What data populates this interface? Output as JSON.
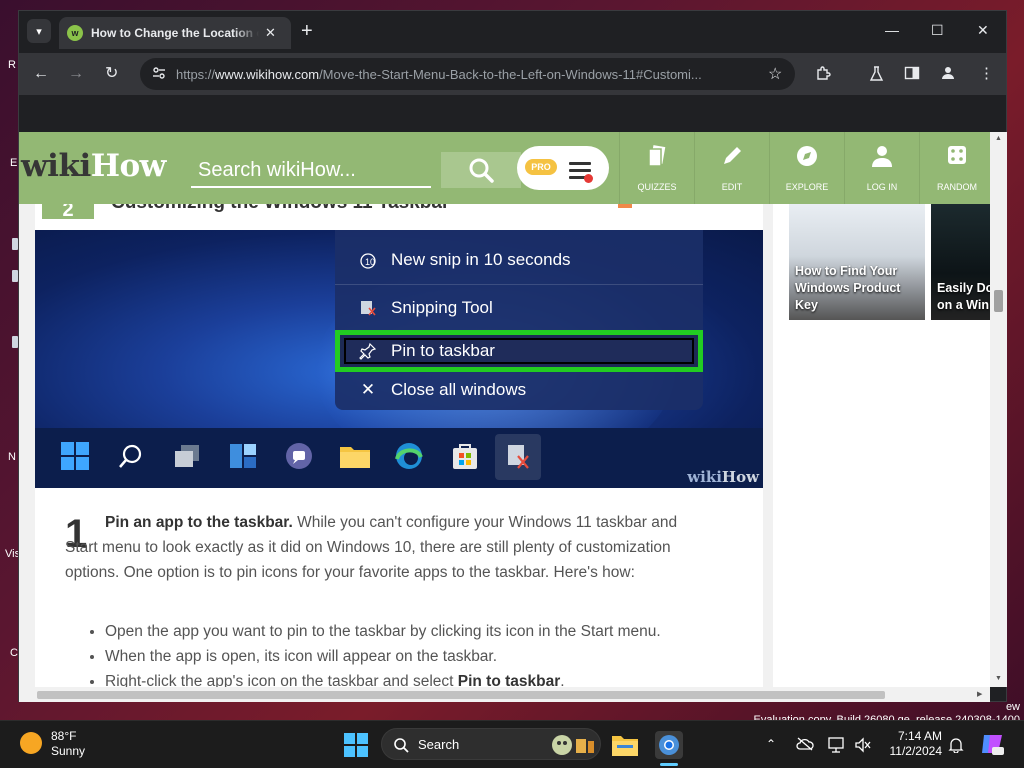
{
  "desktop": {
    "icon_label_fragments": [
      "R",
      "E",
      "N",
      "Vis",
      "C"
    ]
  },
  "browser": {
    "tab": {
      "title": "How to Change the Location o",
      "close": "✕"
    },
    "new_tab": "+",
    "window_controls": {
      "minimize": "—",
      "maximize": "☐",
      "close": "✕"
    },
    "nav": {
      "back": "←",
      "forward": "→",
      "reload": "↻"
    },
    "address": {
      "prefix": "https://",
      "host": "www.wikihow.com",
      "path": "/Move-the-Start-Menu-Back-to-the-Left-on-Windows-11#Customi..."
    },
    "bookmark_star": "☆"
  },
  "wikihow": {
    "logo_wiki": "wiki",
    "logo_how": "How",
    "search_placeholder": "Search wikiHow...",
    "pro_badge": "PRO",
    "nav": [
      {
        "icon": "quizzes-icon",
        "label": "QUIZZES"
      },
      {
        "icon": "edit-icon",
        "label": "EDIT"
      },
      {
        "icon": "explore-icon",
        "label": "EXPLORE"
      },
      {
        "icon": "login-icon",
        "label": "LOG IN"
      },
      {
        "icon": "random-icon",
        "label": "RANDOM"
      }
    ],
    "step_section_num": "2",
    "step_section_title": "Customizing the Windows 11 Taskbar",
    "screenshot": {
      "menu_items": [
        {
          "icon": "timer-icon",
          "label": "New snip in 10 seconds"
        },
        {
          "icon": "snipping-tool-icon",
          "label": "Snipping Tool"
        },
        {
          "icon": "pin-icon",
          "label": "Pin to taskbar"
        },
        {
          "icon": "close-icon",
          "label": "Close all windows"
        }
      ],
      "watermark_wiki": "wiki",
      "watermark_how": "How"
    },
    "step": {
      "number": "1",
      "bold": "Pin an app to the taskbar.",
      "text": " While you can't configure your Windows 11 taskbar and Start menu to look exactly as it did on Windows 10, there are still plenty of customization options. One option is to pin icons for your favorite apps to the taskbar. Here's how:",
      "bullets": [
        {
          "text": "Open the app you want to pin to the taskbar by clicking its icon in the Start menu.",
          "bold": ""
        },
        {
          "text": "When the app is open, its icon will appear on the taskbar.",
          "bold": ""
        },
        {
          "text": "Right-click the app's icon on the taskbar and select ",
          "bold": "Pin to taskbar",
          "after": "."
        }
      ]
    },
    "sidebar_cards": [
      {
        "title": "How to Find Your Windows Product Key"
      },
      {
        "title": "Easily Do and Insta on a Win"
      }
    ]
  },
  "os": {
    "evaluation": "Evaluation copy. Build 26080.ge_release.240308-1400",
    "evaluation_prefix": "ew",
    "weather": {
      "temp": "88°F",
      "condition": "Sunny"
    },
    "search_label": "Search",
    "clock": {
      "time": "7:14 AM",
      "date": "11/2/2024"
    }
  },
  "colors": {
    "wikihow_green": "#93b874",
    "highlight_green": "#22cc22",
    "chrome_dark": "#35363a"
  }
}
